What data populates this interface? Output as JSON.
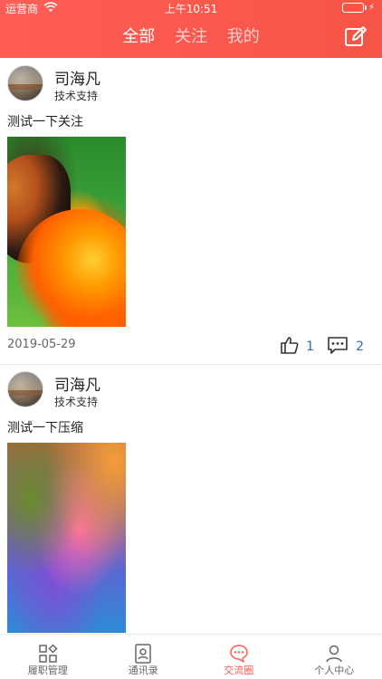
{
  "status_bar": {
    "carrier": "运营商",
    "time": "上午10:51"
  },
  "header": {
    "tabs": [
      {
        "label": "全部",
        "active": true
      },
      {
        "label": "关注",
        "active": false
      },
      {
        "label": "我的",
        "active": false
      }
    ],
    "compose_icon": "edit-icon"
  },
  "feed": {
    "posts": [
      {
        "author": "司海凡",
        "role": "技术支持",
        "content": "测试一下关注",
        "image": "butterfly-on-flower",
        "date": "2019-05-29",
        "likes": "1",
        "comments": "2"
      },
      {
        "author": "司海凡",
        "role": "技术支持",
        "content": "测试一下压缩",
        "image": "abstract-colorful-petals"
      }
    ]
  },
  "tabbar": {
    "items": [
      {
        "label": "履职管理",
        "icon": "grid-apps-icon",
        "active": false
      },
      {
        "label": "通讯录",
        "icon": "contacts-book-icon",
        "active": false
      },
      {
        "label": "交流圈",
        "icon": "chat-bubble-icon",
        "active": true
      },
      {
        "label": "个人中心",
        "icon": "person-icon",
        "active": false
      }
    ]
  },
  "colors": {
    "header_gradient_start": "#ff5e57",
    "header_gradient_end": "#f65446",
    "accent_red": "#ff5b57",
    "count_blue": "#2d6eb0"
  }
}
